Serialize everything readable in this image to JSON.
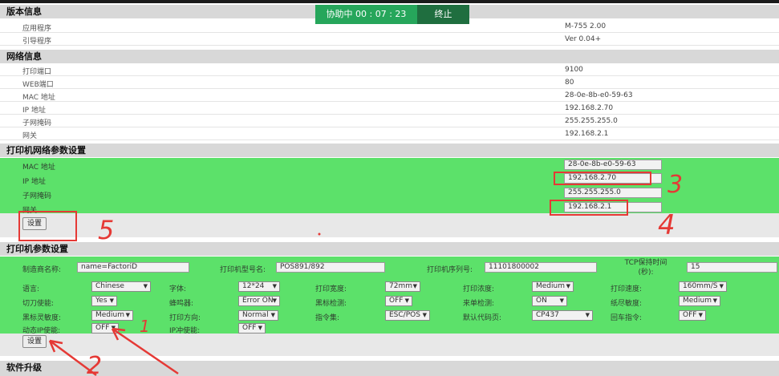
{
  "assist_bar": {
    "timer_text": "协助中 00 : 07 : 23",
    "stop_label": "终止"
  },
  "software": {
    "title": "版本信息",
    "rows": [
      {
        "label": "应用程序",
        "value": "M-755 2.00"
      },
      {
        "label": "引导程序",
        "value": "Ver 0.04+"
      }
    ]
  },
  "network_info": {
    "title": "网络信息",
    "rows": [
      {
        "label": "打印端口",
        "value": "9100"
      },
      {
        "label": "WEB端口",
        "value": "80"
      },
      {
        "label": "MAC 地址",
        "value": "28-0e-8b-e0-59-63"
      },
      {
        "label": "IP 地址",
        "value": "192.168.2.70"
      },
      {
        "label": "子网掩码",
        "value": "255.255.255.0"
      },
      {
        "label": "网关",
        "value": "192.168.2.1"
      }
    ]
  },
  "net_settings": {
    "title": "打印机网络参数设置",
    "mac_label": "MAC 地址",
    "mac_value": "28-0e-8b-e0-59-63",
    "ip_label": "IP 地址",
    "ip_value": "192.168.2.70",
    "mask_label": "子网掩码",
    "mask_value": "255.255.255.0",
    "gw_label": "网关",
    "gw_value": "192.168.2.1",
    "set_button": "设置"
  },
  "printer_settings": {
    "title": "打印机参数设置",
    "maker_label": "制造商名称:",
    "maker_value": "name=FactoriD",
    "model_label": "打印机型号名:",
    "model_value": "POS891/892",
    "serial_label": "打印机序列号:",
    "serial_value": "11101800002",
    "tcp_label": "TCP保持时间(秒):",
    "tcp_value": "15",
    "language_label": "语言:",
    "language_value": "Chinese",
    "font_label": "字体:",
    "font_value": "12*24",
    "width_label": "打印宽度:",
    "width_value": "72mm",
    "density_label": "打印浓度:",
    "density_value": "Medium",
    "speed_label": "打印速度:",
    "speed_value": "160mm/S",
    "cutter_label": "切刀使能:",
    "cutter_value": "Yes",
    "buzzer_label": "蜂鸣器:",
    "buzzer_value": "Error ON",
    "blackmark_label": "黑标检测:",
    "blackmark_value": "OFF",
    "order_label": "来单检测:",
    "order_value": "ON",
    "paper_label": "纸尽敏度:",
    "paper_value": "Medium",
    "bm_sens_label": "黑标灵敏度:",
    "bm_sens_value": "Medium",
    "direction_label": "打印方向:",
    "direction_value": "Normal",
    "cmdset_label": "指令集:",
    "cmdset_value": "ESC/POS",
    "codepage_label": "默认代码页:",
    "codepage_value": "CP437",
    "cr_label": "回车指令:",
    "cr_value": "OFF",
    "dhcp_label": "动态IP使能:",
    "dhcp_value": "OFF",
    "ipcheck_label": "IP冲使能:",
    "ipcheck_value": "OFF",
    "set_button": "设置"
  },
  "upgrade": {
    "title": "软件升级"
  },
  "handwritten": {
    "n1": "1",
    "n2": "2",
    "n3": "3",
    "n4": "4",
    "n5": "5"
  },
  "colors": {
    "green_panel": "#5ce16a",
    "annotation_red": "#e53935",
    "assist_green": "#26a65b"
  },
  "select_arrow": "▼"
}
